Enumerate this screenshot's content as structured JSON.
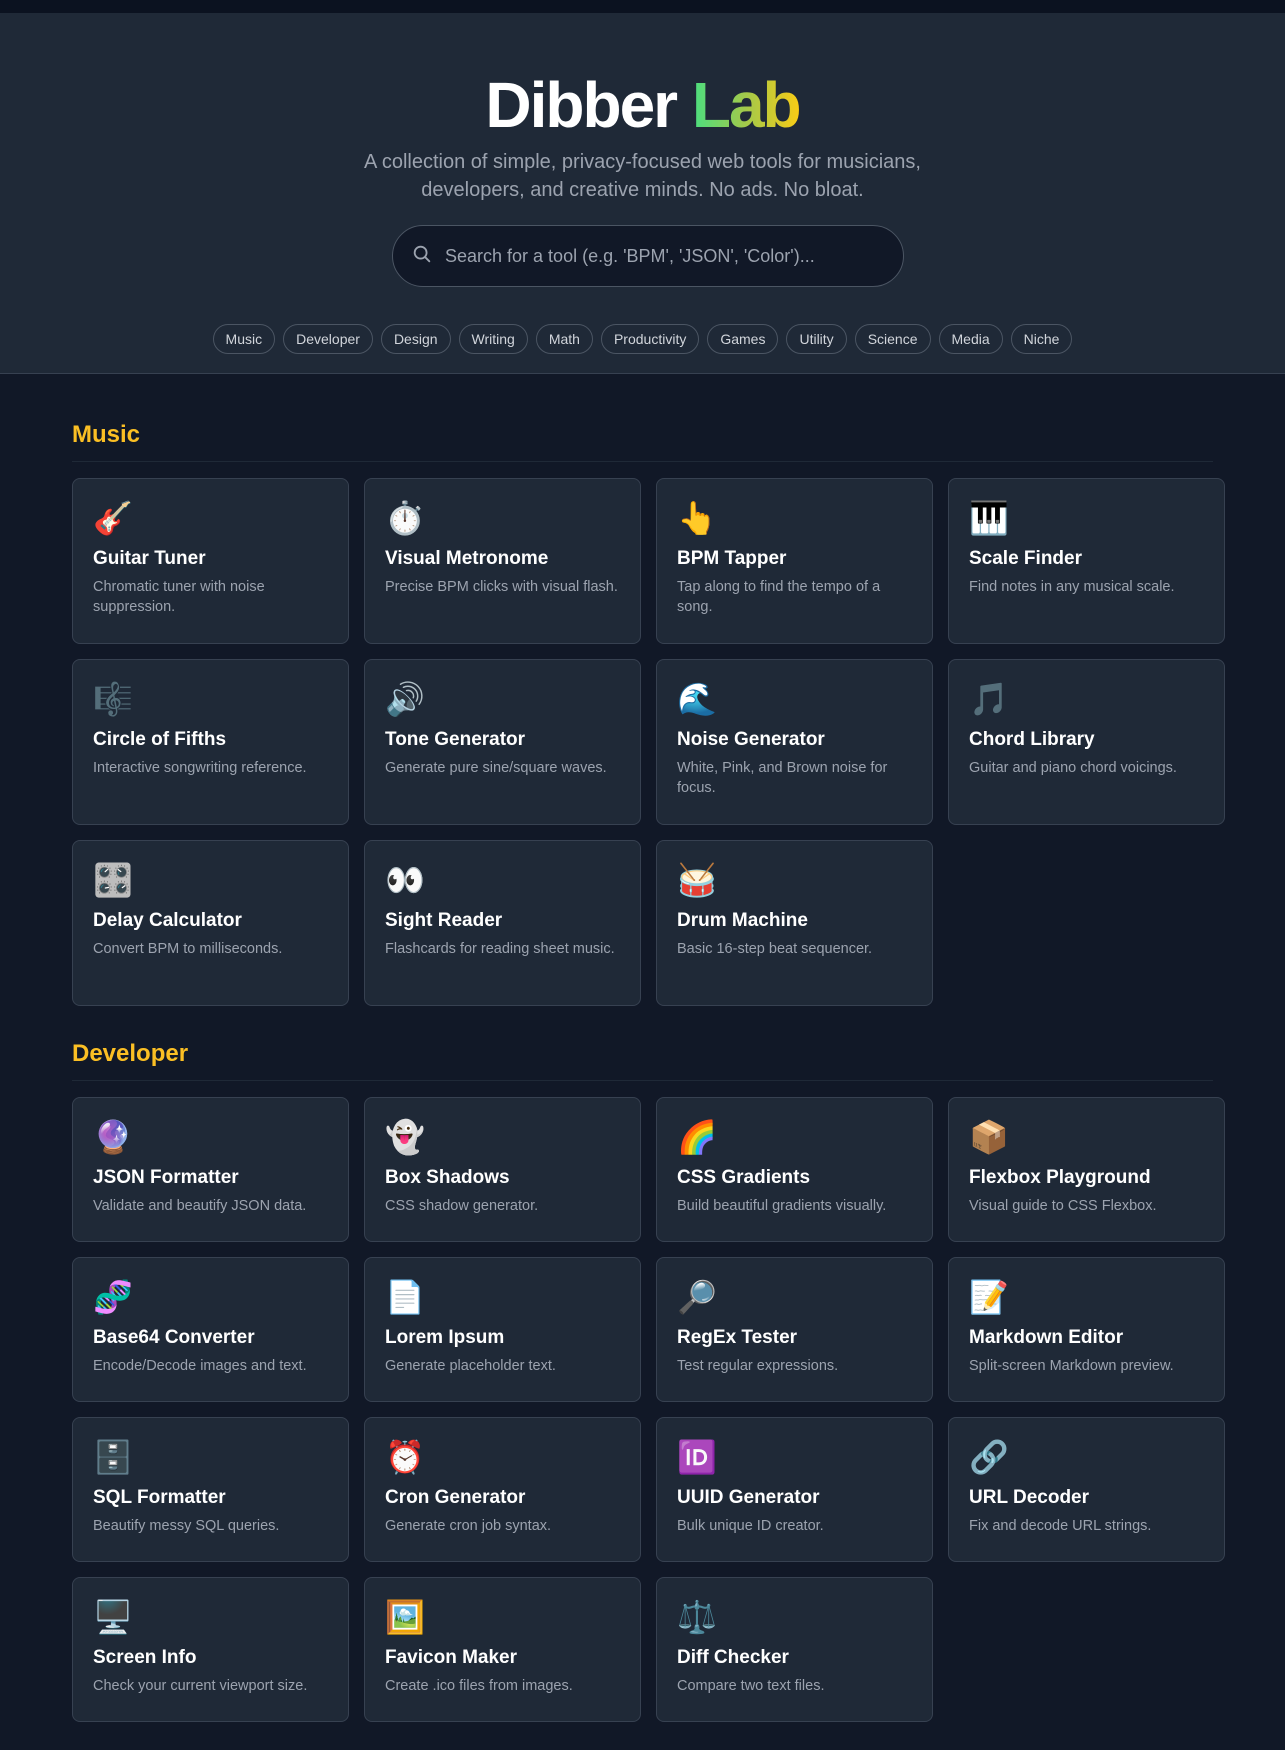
{
  "header": {
    "title_main": "Dibber",
    "title_accent": "Lab",
    "subtitle": "A collection of simple, privacy-focused web tools for musicians, developers, and creative minds. No ads. No bloat.",
    "search_placeholder": "Search for a tool (e.g. 'BPM', 'JSON', 'Color')...",
    "categories": [
      "Music",
      "Developer",
      "Design",
      "Writing",
      "Math",
      "Productivity",
      "Games",
      "Utility",
      "Science",
      "Media",
      "Niche"
    ]
  },
  "sections": [
    {
      "title": "Music",
      "tools": [
        {
          "icon": "🎸",
          "icon_name": "guitar-icon",
          "name": "Guitar Tuner",
          "desc": "Chromatic tuner with noise suppression."
        },
        {
          "icon": "⏱️",
          "icon_name": "stopwatch-icon",
          "name": "Visual Metronome",
          "desc": "Precise BPM clicks with visual flash."
        },
        {
          "icon": "👆",
          "icon_name": "pointing-finger-icon",
          "name": "BPM Tapper",
          "desc": "Tap along to find the tempo of a song."
        },
        {
          "icon": "🎹",
          "icon_name": "piano-keys-icon",
          "name": "Scale Finder",
          "desc": "Find notes in any musical scale."
        },
        {
          "icon": "🎼",
          "icon_name": "musical-score-icon",
          "name": "Circle of Fifths",
          "desc": "Interactive songwriting reference."
        },
        {
          "icon": "🔊",
          "icon_name": "speaker-icon",
          "name": "Tone Generator",
          "desc": "Generate pure sine/square waves."
        },
        {
          "icon": "🌊",
          "icon_name": "wave-icon",
          "name": "Noise Generator",
          "desc": "White, Pink, and Brown noise for focus."
        },
        {
          "icon": "🎵",
          "icon_name": "music-note-icon",
          "name": "Chord Library",
          "desc": "Guitar and piano chord voicings."
        },
        {
          "icon": "🎛️",
          "icon_name": "control-knobs-icon",
          "name": "Delay Calculator",
          "desc": "Convert BPM to milliseconds."
        },
        {
          "icon": "👀",
          "icon_name": "eyes-icon",
          "name": "Sight Reader",
          "desc": "Flashcards for reading sheet music."
        },
        {
          "icon": "🥁",
          "icon_name": "drum-icon",
          "name": "Drum Machine",
          "desc": "Basic 16-step beat sequencer."
        }
      ]
    },
    {
      "title": "Developer",
      "tools": [
        {
          "icon": "🔮",
          "icon_name": "crystal-ball-icon",
          "name": "JSON Formatter",
          "desc": "Validate and beautify JSON data."
        },
        {
          "icon": "👻",
          "icon_name": "ghost-icon",
          "name": "Box Shadows",
          "desc": "CSS shadow generator."
        },
        {
          "icon": "🌈",
          "icon_name": "rainbow-icon",
          "name": "CSS Gradients",
          "desc": "Build beautiful gradients visually."
        },
        {
          "icon": "📦",
          "icon_name": "package-icon",
          "name": "Flexbox Playground",
          "desc": "Visual guide to CSS Flexbox."
        },
        {
          "icon": "🧬",
          "icon_name": "dna-icon",
          "name": "Base64 Converter",
          "desc": "Encode/Decode images and text."
        },
        {
          "icon": "📄",
          "icon_name": "document-icon",
          "name": "Lorem Ipsum",
          "desc": "Generate placeholder text."
        },
        {
          "icon": "🔎",
          "icon_name": "magnifier-icon",
          "name": "RegEx Tester",
          "desc": "Test regular expressions."
        },
        {
          "icon": "📝",
          "icon_name": "memo-icon",
          "name": "Markdown Editor",
          "desc": "Split-screen Markdown preview."
        },
        {
          "icon": "🗄️",
          "icon_name": "file-cabinet-icon",
          "name": "SQL Formatter",
          "desc": "Beautify messy SQL queries."
        },
        {
          "icon": "⏰",
          "icon_name": "alarm-clock-icon",
          "name": "Cron Generator",
          "desc": "Generate cron job syntax."
        },
        {
          "icon": "🆔",
          "icon_name": "id-icon",
          "name": "UUID Generator",
          "desc": "Bulk unique ID creator."
        },
        {
          "icon": "🔗",
          "icon_name": "link-icon",
          "name": "URL Decoder",
          "desc": "Fix and decode URL strings."
        },
        {
          "icon": "🖥️",
          "icon_name": "desktop-computer-icon",
          "name": "Screen Info",
          "desc": "Check your current viewport size."
        },
        {
          "icon": "🖼️",
          "icon_name": "framed-picture-icon",
          "name": "Favicon Maker",
          "desc": "Create .ico files from images."
        },
        {
          "icon": "⚖️",
          "icon_name": "scales-icon",
          "name": "Diff Checker",
          "desc": "Compare two text files."
        }
      ]
    }
  ]
}
